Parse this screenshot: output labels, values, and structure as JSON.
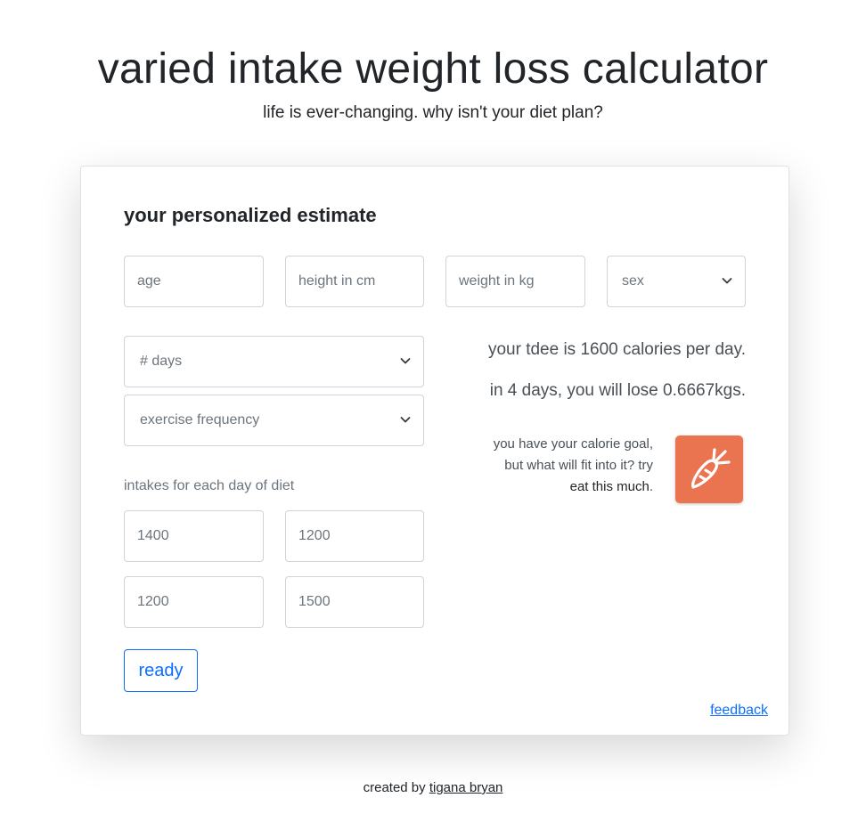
{
  "header": {
    "title": "varied intake weight loss calculator",
    "subtitle": "life is ever-changing. why isn't your diet plan?"
  },
  "card": {
    "title": "your personalized estimate",
    "inputs": {
      "age_placeholder": "age",
      "height_placeholder": "height in cm",
      "weight_placeholder": "weight in kg",
      "sex_select": "sex",
      "days_select": "# days",
      "exercise_select": "exercise frequency"
    },
    "intakes_label": "intakes for each day of diet",
    "intakes": [
      "1400",
      "1200",
      "1200",
      "1500"
    ],
    "ready_label": "ready",
    "results": {
      "tdee": "your tdee is 1600 calories per day.",
      "loss": "in 4 days, you will lose 0.6667kgs."
    },
    "promo": {
      "line1": "you have your calorie goal,",
      "line2": "but what will fit into it? try",
      "link": "eat this much",
      "period": "."
    },
    "feedback_label": "feedback"
  },
  "footer": {
    "prefix": "created by ",
    "author": "tigana bryan"
  },
  "colors": {
    "accent": "#0d6efd",
    "logo_bg": "#ea7350",
    "border": "#ced4da"
  },
  "icons": {
    "select_arrow": "chevron-down-icon",
    "logo": "carrot-icon"
  }
}
